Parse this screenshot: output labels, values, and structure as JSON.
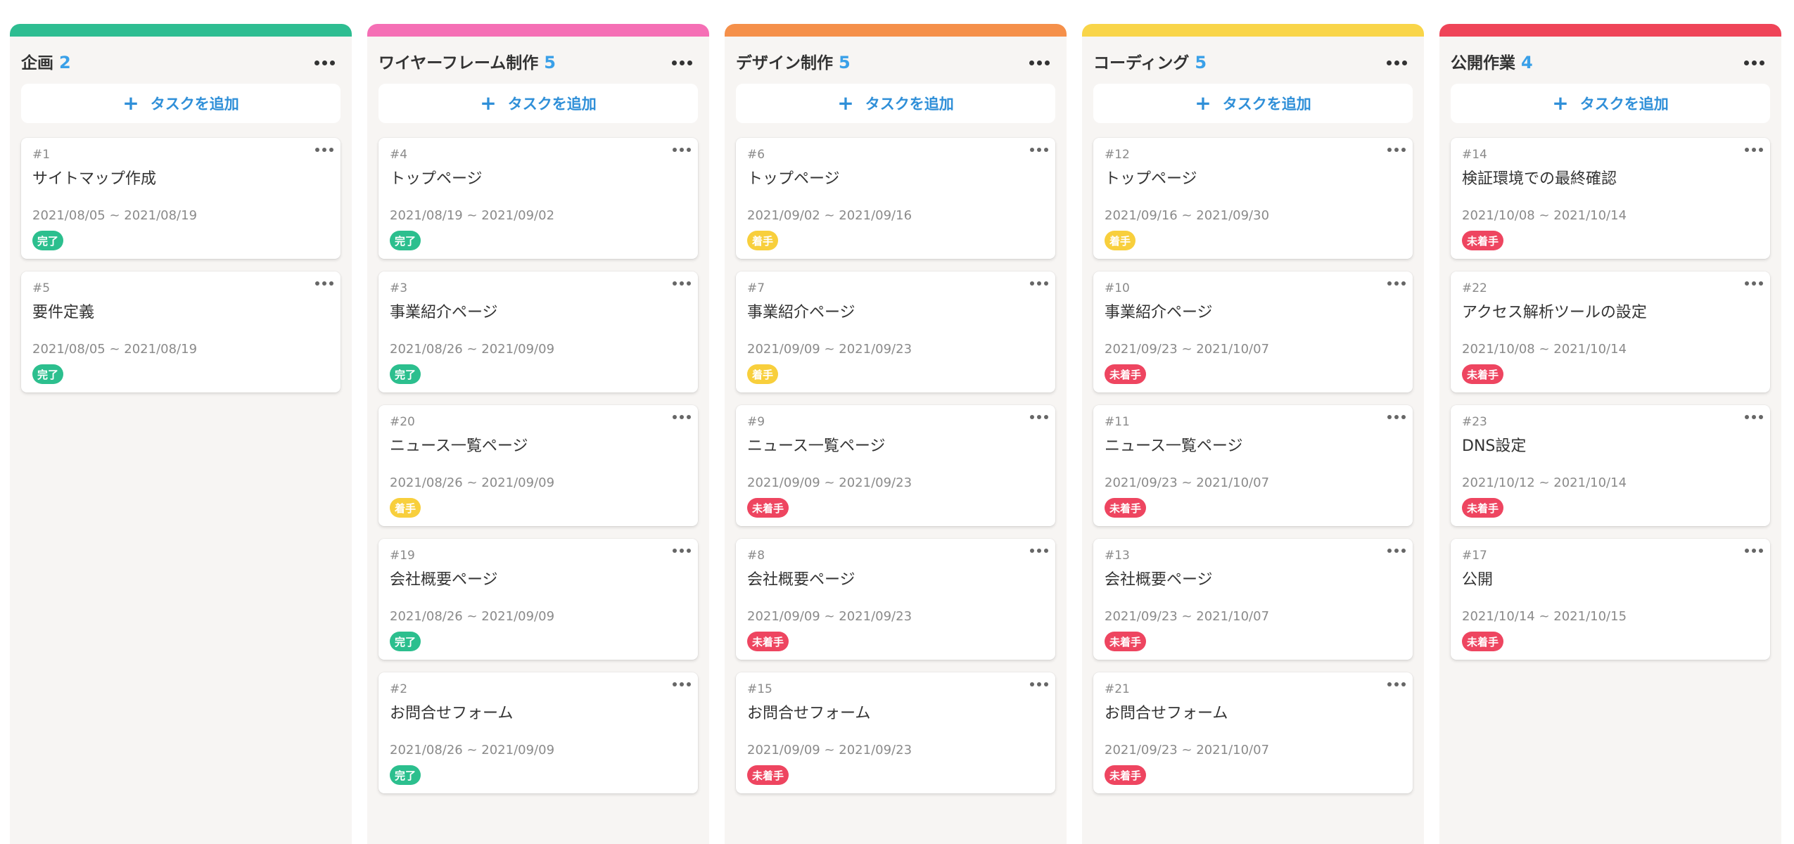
{
  "add_task_label": "タスクを追加",
  "add_icon": "plus-icon",
  "menu_icon": "more-horizontal-icon",
  "colors": {
    "count": "#3aa0e8",
    "add_text": "#2f8fd8",
    "status_done": "#2cbf8e",
    "status_in_progress": "#f8cf3c",
    "status_not_started": "#ee4560"
  },
  "columns": [
    {
      "title": "企画",
      "count": "2",
      "color": "#2ebd91",
      "cards": [
        {
          "id": "#1",
          "title": "サイトマップ作成",
          "dates": "2021/08/05 ~ 2021/08/19",
          "status": "完了"
        },
        {
          "id": "#5",
          "title": "要件定義",
          "dates": "2021/08/05 ~ 2021/08/19",
          "status": "完了"
        }
      ]
    },
    {
      "title": "ワイヤーフレーム制作",
      "count": "5",
      "color": "#f56fb5",
      "cards": [
        {
          "id": "#4",
          "title": "トップページ",
          "dates": "2021/08/19 ~ 2021/09/02",
          "status": "完了"
        },
        {
          "id": "#3",
          "title": "事業紹介ページ",
          "dates": "2021/08/26 ~ 2021/09/09",
          "status": "完了"
        },
        {
          "id": "#20",
          "title": "ニュース一覧ページ",
          "dates": "2021/08/26 ~ 2021/09/09",
          "status": "着手"
        },
        {
          "id": "#19",
          "title": "会社概要ページ",
          "dates": "2021/08/26 ~ 2021/09/09",
          "status": "完了"
        },
        {
          "id": "#2",
          "title": "お問合せフォーム",
          "dates": "2021/08/26 ~ 2021/09/09",
          "status": "完了"
        }
      ]
    },
    {
      "title": "デザイン制作",
      "count": "5",
      "color": "#f5904a",
      "cards": [
        {
          "id": "#6",
          "title": "トップページ",
          "dates": "2021/09/02 ~ 2021/09/16",
          "status": "着手"
        },
        {
          "id": "#7",
          "title": "事業紹介ページ",
          "dates": "2021/09/09 ~ 2021/09/23",
          "status": "着手"
        },
        {
          "id": "#9",
          "title": "ニュース一覧ページ",
          "dates": "2021/09/09 ~ 2021/09/23",
          "status": "未着手"
        },
        {
          "id": "#8",
          "title": "会社概要ページ",
          "dates": "2021/09/09 ~ 2021/09/23",
          "status": "未着手"
        },
        {
          "id": "#15",
          "title": "お問合せフォーム",
          "dates": "2021/09/09 ~ 2021/09/23",
          "status": "未着手"
        }
      ]
    },
    {
      "title": "コーディング",
      "count": "5",
      "color": "#f9d549",
      "cards": [
        {
          "id": "#12",
          "title": "トップページ",
          "dates": "2021/09/16 ~ 2021/09/30",
          "status": "着手"
        },
        {
          "id": "#10",
          "title": "事業紹介ページ",
          "dates": "2021/09/23 ~ 2021/10/07",
          "status": "未着手"
        },
        {
          "id": "#11",
          "title": "ニュース一覧ページ",
          "dates": "2021/09/23 ~ 2021/10/07",
          "status": "未着手"
        },
        {
          "id": "#13",
          "title": "会社概要ページ",
          "dates": "2021/09/23 ~ 2021/10/07",
          "status": "未着手"
        },
        {
          "id": "#21",
          "title": "お問合せフォーム",
          "dates": "2021/09/23 ~ 2021/10/07",
          "status": "未着手"
        }
      ]
    },
    {
      "title": "公開作業",
      "count": "4",
      "color": "#ef4458",
      "cards": [
        {
          "id": "#14",
          "title": "検証環境での最終確認",
          "dates": "2021/10/08 ~ 2021/10/14",
          "status": "未着手"
        },
        {
          "id": "#22",
          "title": "アクセス解析ツールの設定",
          "dates": "2021/10/08 ~ 2021/10/14",
          "status": "未着手"
        },
        {
          "id": "#23",
          "title": "DNS設定",
          "dates": "2021/10/12 ~ 2021/10/14",
          "status": "未着手"
        },
        {
          "id": "#17",
          "title": "公開",
          "dates": "2021/10/14 ~ 2021/10/15",
          "status": "未着手"
        }
      ]
    }
  ]
}
